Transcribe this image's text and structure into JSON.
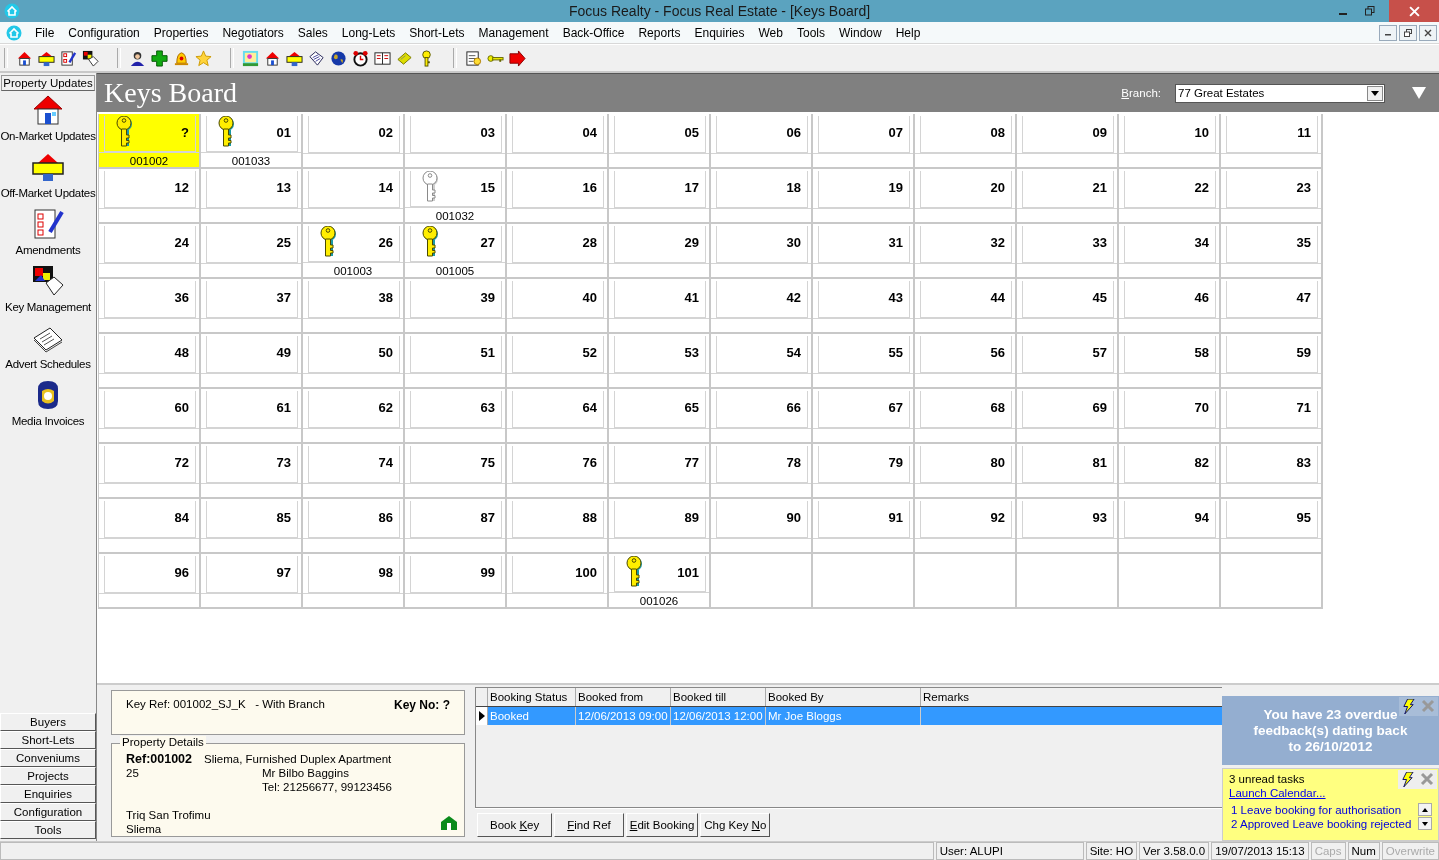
{
  "window": {
    "title": "Focus Realty - Focus Real Estate - [Keys Board]"
  },
  "menu": [
    "File",
    "Configuration",
    "Properties",
    "Negotiators",
    "Sales",
    "Long-Lets",
    "Short-Lets",
    "Management",
    "Back-Office",
    "Reports",
    "Enquiries",
    "Web",
    "Tools",
    "Window",
    "Help"
  ],
  "sidebar": {
    "header": "Property Updates",
    "items": [
      {
        "label": "On-Market Updates",
        "kind": "house"
      },
      {
        "label": "Off-Market Updates",
        "kind": "sold"
      },
      {
        "label": "Amendments",
        "kind": "checklist"
      },
      {
        "label": "Key Management",
        "kind": "palette"
      },
      {
        "label": "Advert Schedules",
        "kind": "newspaper"
      },
      {
        "label": "Media Invoices",
        "kind": "glove"
      }
    ],
    "buttons": [
      "Buyers",
      "Short-Lets",
      "Conveniums",
      "Projects",
      "Enquiries",
      "Configuration",
      "Tools"
    ]
  },
  "board": {
    "title": "Keys Board",
    "branch_label": {
      "accel": "B",
      "rest": "ranch:"
    },
    "branch": "77 Great Estates",
    "slots": [
      {
        "no": "?",
        "kind": "gold-key",
        "ref": "001002",
        "selected": true
      },
      {
        "no": "01",
        "kind": "gold-key",
        "ref": "001033",
        "selected": false
      },
      {
        "no": "02",
        "selected": false
      },
      {
        "no": "03",
        "selected": false
      },
      {
        "no": "04",
        "selected": false
      },
      {
        "no": "05",
        "selected": false
      },
      {
        "no": "06",
        "selected": false
      },
      {
        "no": "07",
        "selected": false
      },
      {
        "no": "08",
        "selected": false
      },
      {
        "no": "09",
        "selected": false
      },
      {
        "no": "10",
        "selected": false
      },
      {
        "no": "11",
        "selected": false
      },
      {
        "no": "12",
        "selected": false
      },
      {
        "no": "13",
        "selected": false
      },
      {
        "no": "14",
        "selected": false
      },
      {
        "no": "15",
        "kind": "silver-key",
        "ref": "001032",
        "selected": false
      },
      {
        "no": "16",
        "selected": false
      },
      {
        "no": "17",
        "selected": false
      },
      {
        "no": "18",
        "selected": false
      },
      {
        "no": "19",
        "selected": false
      },
      {
        "no": "20",
        "selected": false
      },
      {
        "no": "21",
        "selected": false
      },
      {
        "no": "22",
        "selected": false
      },
      {
        "no": "23",
        "selected": false
      },
      {
        "no": "24",
        "selected": false
      },
      {
        "no": "25",
        "selected": false
      },
      {
        "no": "26",
        "kind": "gold-key",
        "ref": "001003",
        "selected": false
      },
      {
        "no": "27",
        "kind": "gold-key",
        "ref": "001005",
        "selected": false
      },
      {
        "no": "28",
        "selected": false
      },
      {
        "no": "29",
        "selected": false
      },
      {
        "no": "30",
        "selected": false
      },
      {
        "no": "31",
        "selected": false
      },
      {
        "no": "32",
        "selected": false
      },
      {
        "no": "33",
        "selected": false
      },
      {
        "no": "34",
        "selected": false
      },
      {
        "no": "35",
        "selected": false
      },
      {
        "no": "36",
        "selected": false
      },
      {
        "no": "37",
        "selected": false
      },
      {
        "no": "38",
        "selected": false
      },
      {
        "no": "39",
        "selected": false
      },
      {
        "no": "40",
        "selected": false
      },
      {
        "no": "41",
        "selected": false
      },
      {
        "no": "42",
        "selected": false
      },
      {
        "no": "43",
        "selected": false
      },
      {
        "no": "44",
        "selected": false
      },
      {
        "no": "45",
        "selected": false
      },
      {
        "no": "46",
        "selected": false
      },
      {
        "no": "47",
        "selected": false
      },
      {
        "no": "48",
        "selected": false
      },
      {
        "no": "49",
        "selected": false
      },
      {
        "no": "50",
        "selected": false
      },
      {
        "no": "51",
        "selected": false
      },
      {
        "no": "52",
        "selected": false
      },
      {
        "no": "53",
        "selected": false
      },
      {
        "no": "54",
        "selected": false
      },
      {
        "no": "55",
        "selected": false
      },
      {
        "no": "56",
        "selected": false
      },
      {
        "no": "57",
        "selected": false
      },
      {
        "no": "58",
        "selected": false
      },
      {
        "no": "59",
        "selected": false
      },
      {
        "no": "60",
        "selected": false
      },
      {
        "no": "61",
        "selected": false
      },
      {
        "no": "62",
        "selected": false
      },
      {
        "no": "63",
        "selected": false
      },
      {
        "no": "64",
        "selected": false
      },
      {
        "no": "65",
        "selected": false
      },
      {
        "no": "66",
        "selected": false
      },
      {
        "no": "67",
        "selected": false
      },
      {
        "no": "68",
        "selected": false
      },
      {
        "no": "69",
        "selected": false
      },
      {
        "no": "70",
        "selected": false
      },
      {
        "no": "71",
        "selected": false
      },
      {
        "no": "72",
        "selected": false
      },
      {
        "no": "73",
        "selected": false
      },
      {
        "no": "74",
        "selected": false
      },
      {
        "no": "75",
        "selected": false
      },
      {
        "no": "76",
        "selected": false
      },
      {
        "no": "77",
        "selected": false
      },
      {
        "no": "78",
        "selected": false
      },
      {
        "no": "79",
        "selected": false
      },
      {
        "no": "80",
        "selected": false
      },
      {
        "no": "81",
        "selected": false
      },
      {
        "no": "82",
        "selected": false
      },
      {
        "no": "83",
        "selected": false
      },
      {
        "no": "84",
        "selected": false
      },
      {
        "no": "85",
        "selected": false
      },
      {
        "no": "86",
        "selected": false
      },
      {
        "no": "87",
        "selected": false
      },
      {
        "no": "88",
        "selected": false
      },
      {
        "no": "89",
        "selected": false
      },
      {
        "no": "90",
        "selected": false
      },
      {
        "no": "91",
        "selected": false
      },
      {
        "no": "92",
        "selected": false
      },
      {
        "no": "93",
        "selected": false
      },
      {
        "no": "94",
        "selected": false
      },
      {
        "no": "95",
        "selected": false
      },
      {
        "no": "96",
        "selected": false
      },
      {
        "no": "97",
        "selected": false
      },
      {
        "no": "98",
        "selected": false
      },
      {
        "no": "99",
        "selected": false
      },
      {
        "no": "100",
        "selected": false
      },
      {
        "no": "101",
        "kind": "gold-key",
        "ref": "001026",
        "selected": false
      }
    ]
  },
  "key_info": {
    "key_ref": "Key Ref: 001002_SJ_K   - With Branch",
    "key_no": "Key No: ?"
  },
  "property_details": {
    "legend": "Property Details",
    "ref": "Ref:001002",
    "description": "Sliema, Furnished Duplex Apartment",
    "number": "25",
    "owner": "Mr Bilbo Baggins",
    "tel": "Tel: 21256677, 99123456",
    "street": "Triq San Trofimu",
    "locality": "Sliema"
  },
  "bookings": {
    "columns": [
      "Booking Status",
      "Booked from",
      "Booked till",
      "Booked By",
      "Remarks"
    ],
    "rows": [
      {
        "cells": [
          "Booked",
          "12/06/2013 09:00",
          "12/06/2013 12:00",
          "Mr Joe Bloggs",
          ""
        ],
        "selected": true
      }
    ]
  },
  "booking_buttons": [
    {
      "before": "Book ",
      "accel": "K",
      "after": "ey"
    },
    {
      "accel": "F",
      "after": "ind Ref"
    },
    {
      "accel": "E",
      "after": "dit Booking"
    },
    {
      "before": "Chg Key ",
      "accel": "N",
      "after": "o"
    }
  ],
  "alerts": {
    "overdue": "You have 23 overdue feedback(s) dating back to 26/10/2012",
    "tasks": "3 unread tasks",
    "calendar_link": "Launch Calendar...",
    "task_items": [
      "1 Leave booking for authorisation",
      "2 Approved Leave booking rejected"
    ]
  },
  "status_bar": [
    {
      "text": "User: ALUPI",
      "disabled": false
    },
    {
      "text": "Site: HO",
      "disabled": false
    },
    {
      "text": "Ver 3.58.0.0",
      "disabled": false
    },
    {
      "text": "19/07/2013 15:13",
      "disabled": false
    },
    {
      "text": "Caps",
      "disabled": true
    },
    {
      "text": "Num",
      "disabled": false
    },
    {
      "text": "Overwrite",
      "disabled": true
    }
  ]
}
